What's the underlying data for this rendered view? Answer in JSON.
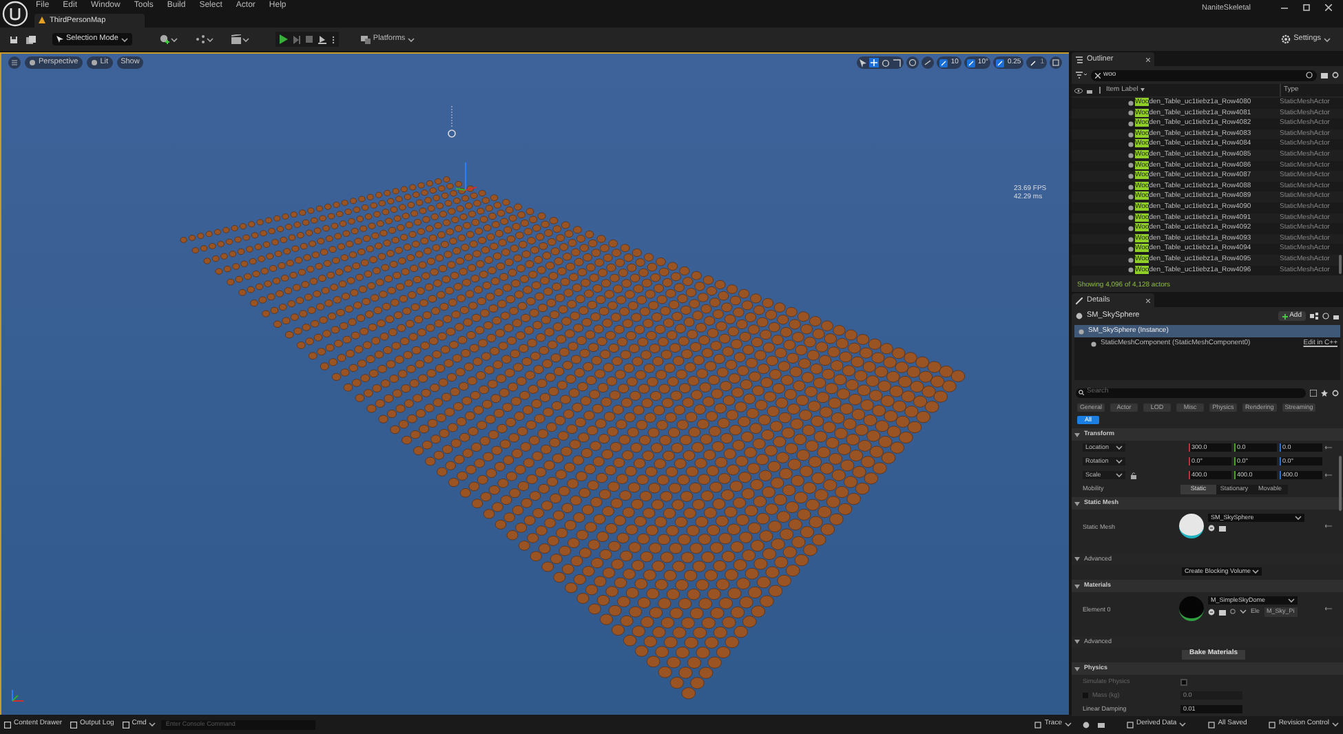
{
  "menu": [
    "File",
    "Edit",
    "Window",
    "Tools",
    "Build",
    "Select",
    "Actor",
    "Help"
  ],
  "document_tab": {
    "title": "ThirdPersonMap"
  },
  "window": {
    "title": "NaniteSkeletal"
  },
  "toolbar": {
    "selection_mode": "Selection Mode",
    "platforms": "Platforms",
    "settings": "Settings"
  },
  "viewport": {
    "menu_buttons": [
      "Perspective",
      "Lit",
      "Show"
    ],
    "snap": [
      {
        "label": "10",
        "on": true
      },
      {
        "label": "10°",
        "on": true
      },
      {
        "label": "0.25",
        "on": true
      },
      {
        "label": "1",
        "on": false
      }
    ],
    "stats": [
      "23.69 FPS",
      "42.29 ms"
    ]
  },
  "outliner": {
    "title": "Outliner",
    "search": {
      "value": "woo"
    },
    "columns": [
      "Item Label",
      "Type"
    ],
    "rows": [
      {
        "match": "Woo",
        "rest": "den_Table_uc1tiebz1a_Row4080",
        "type": "StaticMeshActor"
      },
      {
        "match": "Woo",
        "rest": "den_Table_uc1tiebz1a_Row4081",
        "type": "StaticMeshActor"
      },
      {
        "match": "Woo",
        "rest": "den_Table_uc1tiebz1a_Row4082",
        "type": "StaticMeshActor"
      },
      {
        "match": "Woo",
        "rest": "den_Table_uc1tiebz1a_Row4083",
        "type": "StaticMeshActor"
      },
      {
        "match": "Woo",
        "rest": "den_Table_uc1tiebz1a_Row4084",
        "type": "StaticMeshActor"
      },
      {
        "match": "Woo",
        "rest": "den_Table_uc1tiebz1a_Row4085",
        "type": "StaticMeshActor"
      },
      {
        "match": "Woo",
        "rest": "den_Table_uc1tiebz1a_Row4086",
        "type": "StaticMeshActor"
      },
      {
        "match": "Woo",
        "rest": "den_Table_uc1tiebz1a_Row4087",
        "type": "StaticMeshActor"
      },
      {
        "match": "Woo",
        "rest": "den_Table_uc1tiebz1a_Row4088",
        "type": "StaticMeshActor"
      },
      {
        "match": "Woo",
        "rest": "den_Table_uc1tiebz1a_Row4089",
        "type": "StaticMeshActor"
      },
      {
        "match": "Woo",
        "rest": "den_Table_uc1tiebz1a_Row4090",
        "type": "StaticMeshActor"
      },
      {
        "match": "Woo",
        "rest": "den_Table_uc1tiebz1a_Row4091",
        "type": "StaticMeshActor"
      },
      {
        "match": "Woo",
        "rest": "den_Table_uc1tiebz1a_Row4092",
        "type": "StaticMeshActor"
      },
      {
        "match": "Woo",
        "rest": "den_Table_uc1tiebz1a_Row4093",
        "type": "StaticMeshActor"
      },
      {
        "match": "Woo",
        "rest": "den_Table_uc1tiebz1a_Row4094",
        "type": "StaticMeshActor"
      },
      {
        "match": "Woo",
        "rest": "den_Table_uc1tiebz1a_Row4095",
        "type": "StaticMeshActor"
      },
      {
        "match": "Woo",
        "rest": "den_Table_uc1tiebz1a_Row4096",
        "type": "StaticMeshActor"
      }
    ],
    "status": "Showing 4,096 of 4,128 actors"
  },
  "details": {
    "title": "Details",
    "actor": "SM_SkySphere",
    "add": "Add",
    "components": [
      {
        "label": "SM_SkySphere (Instance)",
        "selected": true
      },
      {
        "label": "StaticMeshComponent (StaticMeshComponent0)",
        "selected": false,
        "action": "Edit in C++"
      }
    ],
    "search": {
      "placeholder": "Search"
    },
    "filters": [
      {
        "label": "General",
        "selected": false
      },
      {
        "label": "Actor",
        "selected": false
      },
      {
        "label": "LOD",
        "selected": false
      },
      {
        "label": "Misc",
        "selected": false
      },
      {
        "label": "Physics",
        "selected": false
      },
      {
        "label": "Rendering",
        "selected": false
      },
      {
        "label": "Streaming",
        "selected": false
      },
      {
        "label": "All",
        "selected": true
      }
    ],
    "transform": {
      "title": "Transform",
      "rows": [
        {
          "label": "Location",
          "values": [
            "300.0",
            "0.0",
            "0.0"
          ]
        },
        {
          "label": "Rotation",
          "values": [
            "0.0°",
            "0.0°",
            "0.0°"
          ]
        },
        {
          "label": "Scale",
          "values": [
            "400.0",
            "400.0",
            "400.0"
          ]
        }
      ],
      "mobility": {
        "label": "Mobility",
        "options": [
          {
            "label": "Static",
            "selected": true
          },
          {
            "label": "Stationary",
            "selected": false
          },
          {
            "label": "Movable",
            "selected": false
          }
        ]
      }
    },
    "static_mesh": {
      "title": "Static Mesh",
      "label": "Static Mesh",
      "value": "SM_SkySphere",
      "advanced": "Advanced",
      "button": "Create Blocking Volume"
    },
    "materials": {
      "title": "Materials",
      "label": "Element 0",
      "value": "M_SimpleSkyDome",
      "short_label": "Ele",
      "short_value": "M_Sky_Pi",
      "advanced": "Advanced",
      "button": "Bake Materials"
    },
    "physics": {
      "title": "Physics",
      "rows": [
        {
          "label": "Simulate Physics",
          "kind": "checkbox",
          "checked": false,
          "disabled": true
        },
        {
          "label": "Mass (kg)",
          "kind": "field",
          "value": "0.0",
          "disabled": true
        },
        {
          "label": "Linear Damping",
          "kind": "field",
          "value": "0.01",
          "disabled": false
        }
      ]
    }
  },
  "status_bar": {
    "left": [
      "Content Drawer",
      "Output Log",
      "Cmd"
    ],
    "console": {
      "placeholder": "Enter Console Command"
    },
    "right": [
      "Trace",
      "Derived Data",
      "All Saved",
      "Revision Control"
    ]
  }
}
